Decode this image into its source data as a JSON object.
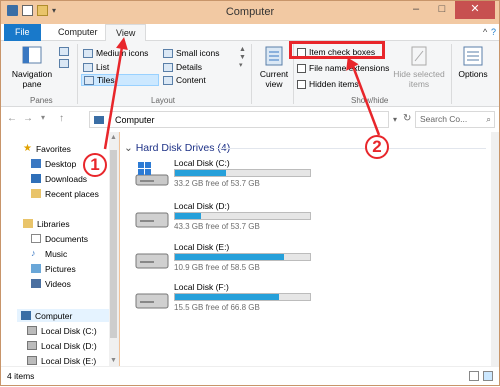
{
  "title": "Computer",
  "tabs": {
    "file": "File",
    "computer": "Computer",
    "view": "View"
  },
  "ribbon": {
    "navigation_pane": "Navigation pane",
    "panes_label": "Panes",
    "medium_icons": "Medium icons",
    "small_icons": "Small icons",
    "list": "List",
    "details": "Details",
    "tiles": "Tiles",
    "content": "Content",
    "layout_label": "Layout",
    "current_view": "Current view",
    "item_check_boxes": "Item check boxes",
    "file_name_extensions": "File name extensions",
    "hidden_items": "Hidden items",
    "hide_selected": "Hide selected items",
    "showhide_label": "Show/hide",
    "options": "Options"
  },
  "address": {
    "path": "Computer",
    "search_placeholder": "Search Co..."
  },
  "nav": {
    "favorites": "Favorites",
    "desktop": "Desktop",
    "downloads": "Downloads",
    "recent": "Recent places",
    "libraries": "Libraries",
    "documents": "Documents",
    "music": "Music",
    "pictures": "Pictures",
    "videos": "Videos",
    "computer": "Computer",
    "drive_c": "Local Disk (C:)",
    "drive_d": "Local Disk (D:)",
    "drive_e": "Local Disk (E:)"
  },
  "section": {
    "title": "Hard Disk Drives (4)"
  },
  "drives": [
    {
      "name": "Local Disk (C:)",
      "free": "33.2 GB free of 53.7 GB",
      "used_fraction": 0.38
    },
    {
      "name": "Local Disk (D:)",
      "free": "43.3 GB free of 53.7 GB",
      "used_fraction": 0.19
    },
    {
      "name": "Local Disk (E:)",
      "free": "10.9 GB free of 58.5 GB",
      "used_fraction": 0.81
    },
    {
      "name": "Local Disk (F:)",
      "free": "15.5 GB free of 66.8 GB",
      "used_fraction": 0.77
    }
  ],
  "status": {
    "items": "4 items"
  },
  "annotations": {
    "marker1": "1",
    "marker2": "2"
  },
  "colors": {
    "accent": "#1979ca",
    "bar": "#26a0da",
    "annotation": "#e8262b"
  }
}
